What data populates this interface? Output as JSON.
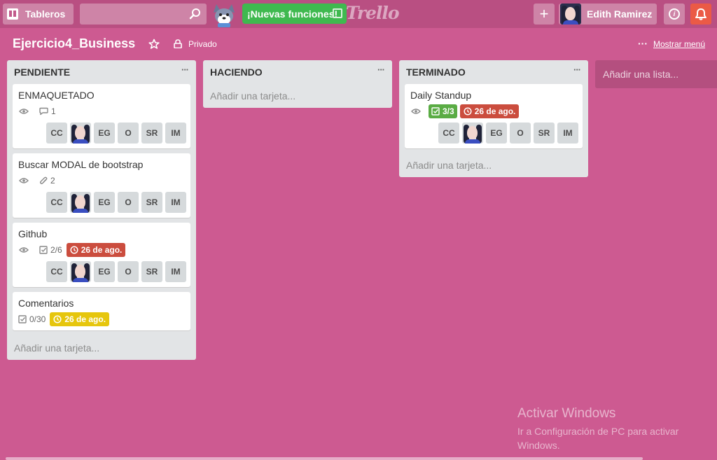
{
  "header": {
    "boards_label": "Tableros",
    "new_features_label": "¡Nuevas funciones!",
    "logo_text": "Trello",
    "plus_symbol": "+",
    "user_name": "Edith Ramirez",
    "info_symbol": "i"
  },
  "board": {
    "title": "Ejercicio4_Business",
    "visibility": "Privado",
    "menu_dots": "···",
    "show_menu": "Mostrar menú"
  },
  "lists": [
    {
      "title": "PENDIENTE",
      "menu": "···",
      "add_card": "Añadir una tarjeta...",
      "cards": [
        {
          "title": "ENMAQUETADO",
          "comments": "1",
          "members": [
            "CC",
            "avatar",
            "EG",
            "O",
            "SR",
            "IM"
          ]
        },
        {
          "title": "Buscar MODAL de bootstrap",
          "attachments": "2",
          "members": [
            "CC",
            "avatar",
            "EG",
            "O",
            "SR",
            "IM"
          ]
        },
        {
          "title": "Github",
          "checklist": "2/6",
          "due": "26 de ago.",
          "members": [
            "CC",
            "avatar",
            "EG",
            "O",
            "SR",
            "IM"
          ]
        },
        {
          "title": "Comentarios",
          "checklist": "0/30",
          "due": "26 de ago."
        }
      ]
    },
    {
      "title": "HACIENDO",
      "menu": "···",
      "add_card": "Añadir una tarjeta...",
      "cards": []
    },
    {
      "title": "TERMINADO",
      "menu": "···",
      "add_card": "Añadir una tarjeta...",
      "cards": [
        {
          "title": "Daily Standup",
          "checklist": "3/3",
          "due": "26 de ago.",
          "members": [
            "CC",
            "avatar",
            "EG",
            "O",
            "SR",
            "IM"
          ]
        }
      ]
    }
  ],
  "add_list": "Añadir una lista...",
  "members": {
    "cc": "CC",
    "eg": "EG",
    "o": "O",
    "sr": "SR",
    "im": "IM"
  },
  "watermark": {
    "line1": "Activar Windows",
    "line2": "Ir a Configuración de PC para activar Windows."
  },
  "colors": {
    "background": "#cd5a91",
    "header": "#b94f82",
    "due_red": "#cb4d3e",
    "due_yellow": "#e6c60d",
    "complete_green": "#5aac44",
    "notification": "#eb5a46"
  }
}
